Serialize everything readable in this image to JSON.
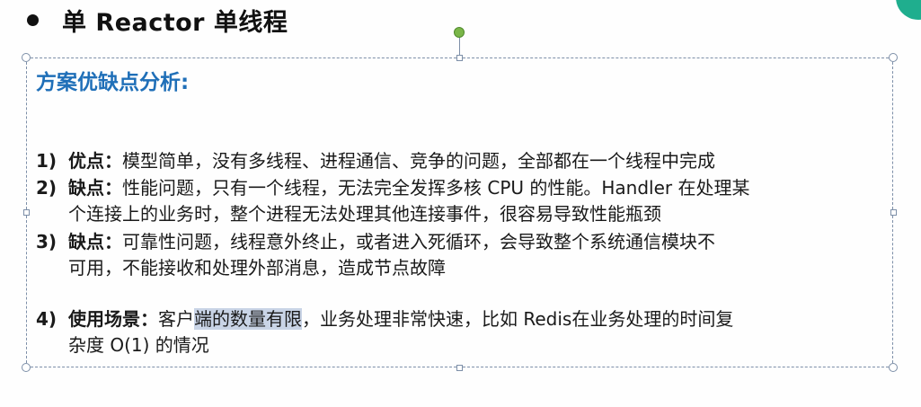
{
  "slide": {
    "title": "单 Reactor 单线程",
    "heading": "方案优缺点分析:",
    "items": [
      {
        "num": "1)",
        "label": "优点：",
        "text": "模型简单，没有多线程、进程通信、竞争的问题，全部都在一个线程中完成"
      },
      {
        "num": "2)",
        "label": "缺点：",
        "text": "性能问题，只有一个线程，无法完全发挥多核 CPU 的性能。Handler 在处理某",
        "text2": "个连接上的业务时，整个进程无法处理其他连接事件，很容易导致性能瓶颈"
      },
      {
        "num": "3)",
        "label": "缺点：",
        "text": "可靠性问题，线程意外终止，或者进入死循环，会导致整个系统通信模块不",
        "text2": "可用，不能接收和处理外部消息，造成节点故障"
      },
      {
        "num": "4)",
        "label": "使用场景：",
        "text_pre": "客户",
        "text_highlight": "端的数量有限",
        "text_post": "，业务处理非常快速，比如 Redis在业务处理的时间复",
        "text2": "杂度 O(1) 的情况"
      }
    ]
  },
  "colors": {
    "heading": "#1f6fb8",
    "selection_highlight": "#c9d4e6",
    "rotate_handle": "#7ab648",
    "frame_border": "#7d8fa8",
    "corner_accent": "#1fae8e"
  }
}
